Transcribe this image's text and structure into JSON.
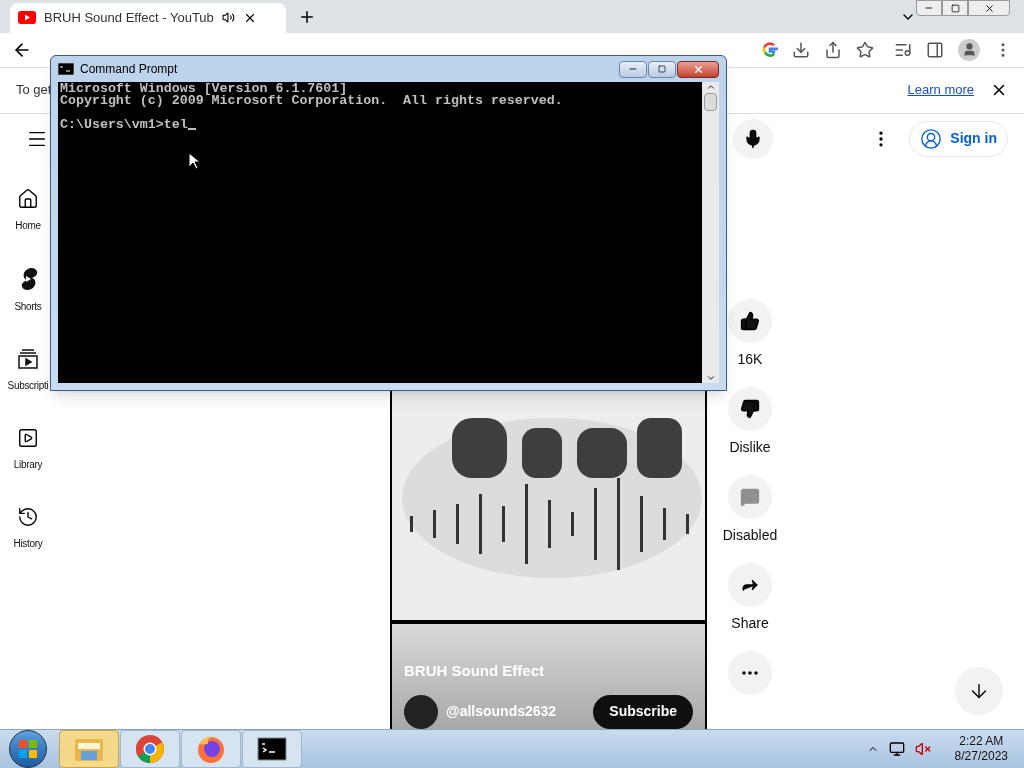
{
  "browser": {
    "tab": {
      "title": "BRUH Sound Effect - YouTub",
      "audio": true
    },
    "info_bar": {
      "text": "To get",
      "link": "Learn more"
    }
  },
  "youtube": {
    "sign_in": "Sign in",
    "sidebar": [
      {
        "kind": "home",
        "label": "Home"
      },
      {
        "kind": "shorts",
        "label": "Shorts"
      },
      {
        "kind": "subscriptions",
        "label": "Subscripti"
      },
      {
        "kind": "library",
        "label": "Library"
      },
      {
        "kind": "history",
        "label": "History"
      }
    ],
    "short": {
      "title": "BRUH Sound Effect",
      "channel": "@allsounds2632",
      "subscribe": "Subscribe"
    },
    "actions": [
      {
        "kind": "like",
        "label": "16K"
      },
      {
        "kind": "dislike",
        "label": "Dislike"
      },
      {
        "kind": "comments",
        "label": "Disabled"
      },
      {
        "kind": "share",
        "label": "Share"
      },
      {
        "kind": "more"
      }
    ]
  },
  "cmd": {
    "title": "Command Prompt",
    "output": [
      "Microsoft Windows [Version 6.1.7601]",
      "Copyright (c) 2009 Microsoft Corporation.  All rights reserved."
    ],
    "prompt": "C:\\Users\\vm1>tel"
  },
  "taskbar": {
    "apps": [
      {
        "kind": "explorer"
      },
      {
        "kind": "chrome"
      },
      {
        "kind": "firefox"
      },
      {
        "kind": "cmd"
      }
    ],
    "time": "2:22 AM",
    "date": "8/27/2023"
  }
}
